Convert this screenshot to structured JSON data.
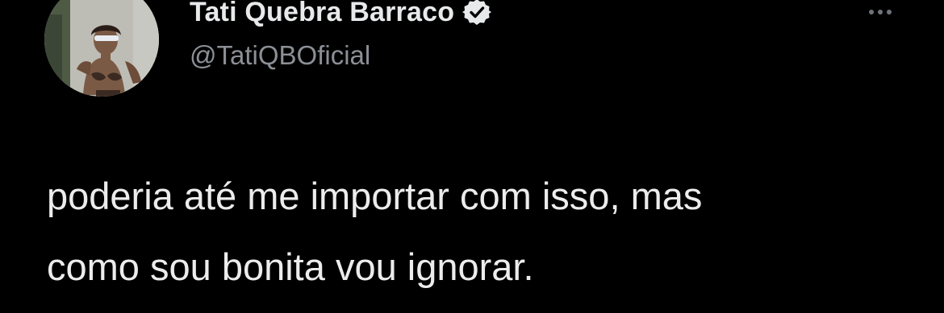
{
  "author": {
    "display_name": "Tati Quebra Barraco",
    "handle": "@TatiQBOficial",
    "verified": true,
    "avatar_icon": "profile-photo",
    "verified_icon": "verified-badge-icon"
  },
  "tweet": {
    "lines": [
      "poderia até me importar com isso, mas",
      "como sou bonita vou ignorar."
    ]
  },
  "more_menu": {
    "icon": "more-options-icon"
  },
  "colors": {
    "background": "#000000",
    "name_text": "#e7e9ea",
    "handle_text": "#8b9096",
    "body_text": "#ececec",
    "icon_gray": "#6f747a"
  }
}
